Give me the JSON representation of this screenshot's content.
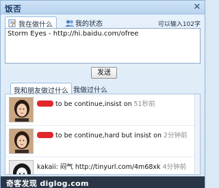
{
  "window": {
    "title": "饭否"
  },
  "status_tabs": {
    "doing_label": "我在做什么",
    "my_status_label": "我的状态"
  },
  "quota_text": "可以输入102字",
  "input": {
    "value": "Storm Eyes - http://hi.baidu.com/ofree"
  },
  "send_label": "发送",
  "feed_tabs": {
    "friends_label": "我和朋友做过什么",
    "mine_label": "我做过什么"
  },
  "feed": [
    {
      "text": "to be continue,insist on",
      "time": "51秒前"
    },
    {
      "text": "to be continue,hard but insist on",
      "time": "2分钟前"
    },
    {
      "text": "kakaii: 闷气 http://tinyurl.com/4m68xk",
      "time": "4分钟前"
    }
  ],
  "footer": {
    "watermark": "奇客发现 diglog.com"
  }
}
